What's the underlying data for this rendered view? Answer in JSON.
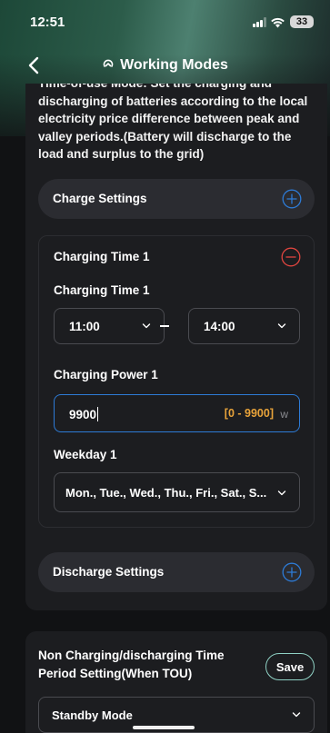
{
  "status_bar": {
    "time": "12:51",
    "battery": "33",
    "icons": [
      "signal-icon",
      "wifi-icon",
      "battery-icon"
    ]
  },
  "nav": {
    "title": "Working Modes",
    "back_icon": "chevron-left-icon",
    "title_icon": "mode-icon"
  },
  "description": "Time-of-use Mode: Set the charging and discharging of batteries according to the local electricity price difference between peak and valley periods.(Battery will discharge to the load and surplus to the grid)",
  "charge_settings": {
    "label": "Charge Settings",
    "icon": "plus-circle-icon",
    "charging_time": {
      "header": "Charging Time 1",
      "remove_icon": "minus-circle-icon",
      "time_label": "Charging Time 1",
      "start_time": "11:00",
      "end_time": "14:00",
      "power_label": "Charging Power 1",
      "power_value": "9900",
      "power_range": "[0 - 9900]",
      "power_unit": "w",
      "weekday_label": "Weekday 1",
      "weekday_value": "Mon., Tue., Wed., Thu., Fri., Sat., S..."
    }
  },
  "discharge_settings": {
    "label": "Discharge Settings",
    "icon": "plus-circle-icon"
  },
  "non_charging": {
    "label": "Non Charging/discharging Time Period Setting(When TOU)",
    "save_label": "Save",
    "mode_value": "Standby Mode"
  },
  "colors": {
    "accent_blue": "#2d7bd6",
    "remove_red": "#e0453f",
    "range_orange": "#e8a33a",
    "save_border": "#8fd1c4",
    "card_bg": "#1c1d20"
  }
}
